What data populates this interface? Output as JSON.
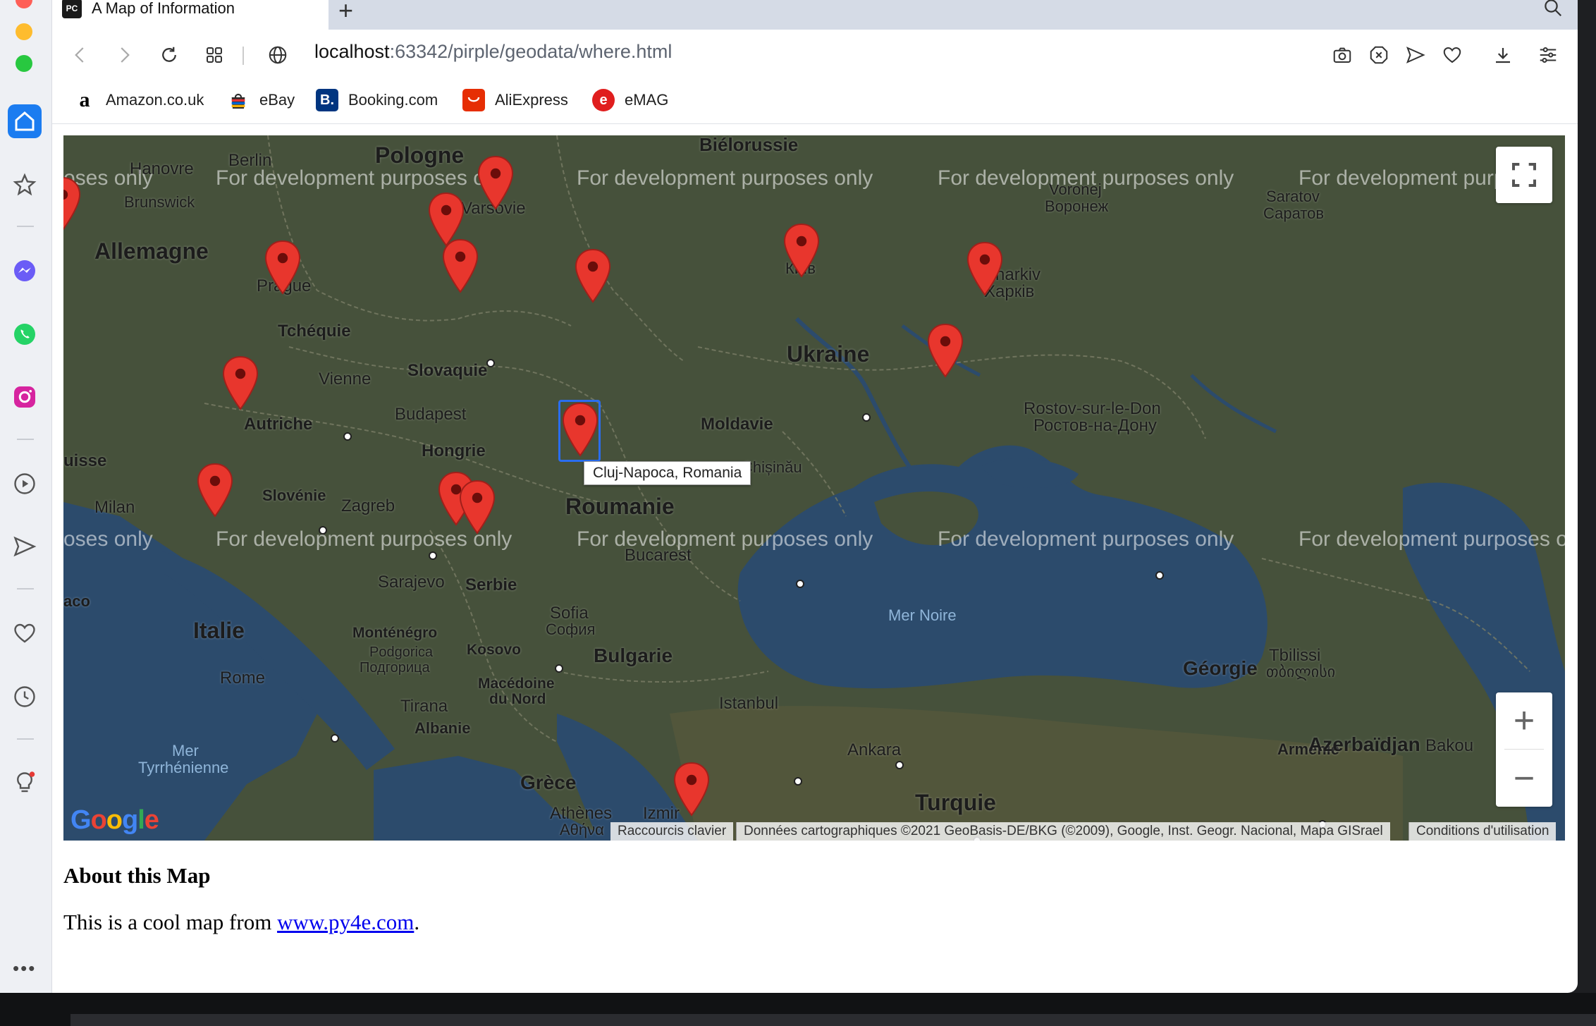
{
  "tab": {
    "title": "A Map of Information",
    "favicon": "PC"
  },
  "address": {
    "host": "localhost",
    "path": ":63342/pirple/geodata/where.html"
  },
  "bookmarks": [
    {
      "label": "Amazon.co.uk",
      "icon": "amazon-icon",
      "color": "#000000"
    },
    {
      "label": "eBay",
      "icon": "ebay-icon",
      "color": "#e53238"
    },
    {
      "label": "Booking.com",
      "icon": "booking-icon",
      "color": "#003580"
    },
    {
      "label": "AliExpress",
      "icon": "aliexpress-icon",
      "color": "#e62e04"
    },
    {
      "label": "eMAG",
      "icon": "emag-icon",
      "color": "#e01e1e"
    }
  ],
  "map": {
    "watermark": "For development purposes only",
    "watermark_partial_left": "oses only",
    "watermark_partial_right": "For development purp",
    "watermark_partial_right2": "For development purposes o",
    "tooltip": "Cluj-Napoca, Romania",
    "shortcuts": "Raccourcis clavier",
    "attribution": "Données cartographiques ©2021 GeoBasis-DE/BKG (©2009), Google, Inst. Geogr. Nacional, Mapa GISrael",
    "terms": "Conditions d'utilisation",
    "google": "Google",
    "zoom_in": "+",
    "zoom_out": "−",
    "labels": {
      "pologne": "Pologne",
      "bielorussie": "Biélorussie",
      "hanovre": "Hanovre",
      "berlin": "Berlin",
      "brunswick": "Brunswick",
      "allemagne": "Allemagne",
      "varsovie": "Varsovie",
      "prague": "Prague",
      "tcheque": "Tchéquie",
      "slovaquie": "Slovaquie",
      "vienne": "Vienne",
      "autriche": "Autriche",
      "budapest": "Budapest",
      "hongrie": "Hongrie",
      "suisse": "uisse",
      "milan": "Milan",
      "slovenie": "Slovénie",
      "zagreb": "Zagreb",
      "sarajevo": "Sarajevo",
      "serbie": "Serbie",
      "roumanie": "Roumanie",
      "bucarest": "Bucarest",
      "moldavie": "Moldavie",
      "chisinau": "Chișinău",
      "ukraine": "Ukraine",
      "kyiv": "Київ",
      "kharkiv": "Kharkiv",
      "kharkiv_cyr": "Харків",
      "voronej": "Voronej",
      "voronej_cyr": "Воронеж",
      "saratov": "Saratov",
      "saratov_cyr": "Саратов",
      "rostov": "Rostov-sur-le-Don",
      "rostov_cyr": "Ростов-на-Дону",
      "mer_noire": "Mer Noire",
      "italie": "Italie",
      "rome": "Rome",
      "mer_tyr1": "Mer",
      "mer_tyr2": "Tyrrhénienne",
      "montenegro": "Monténégro",
      "podgorica": "Podgorica",
      "podgorica_cyr": "Подгорица",
      "kosovo": "Kosovo",
      "macedoine": "Macédoine",
      "du_nord": "du Nord",
      "tirana": "Tirana",
      "albanie": "Albanie",
      "sofia": "Sofia",
      "sofia_cyr": "София",
      "bulgarie": "Bulgarie",
      "istanbul": "Istanbul",
      "grece": "Grèce",
      "athenes": "Athènes",
      "athenes_cyr": "Αθήνα",
      "izmir": "Izmir",
      "ankara": "Ankara",
      "turquie": "Turquie",
      "georgie": "Géorgie",
      "tbilissi": "Tbilissi",
      "tbilissi_geo": "თბილისი",
      "armenie": "Arménie",
      "azerbaidjan": "Azerbaïdjan",
      "bakou": "Bakou",
      "aco": "aco"
    }
  },
  "page": {
    "heading": "About this Map",
    "text_before": "This is a cool map from ",
    "link": "www.py4e.com",
    "text_after": "."
  },
  "colors": {
    "marker": "#e8362d",
    "accent": "#1b7cf0",
    "link": "#0000ee"
  }
}
